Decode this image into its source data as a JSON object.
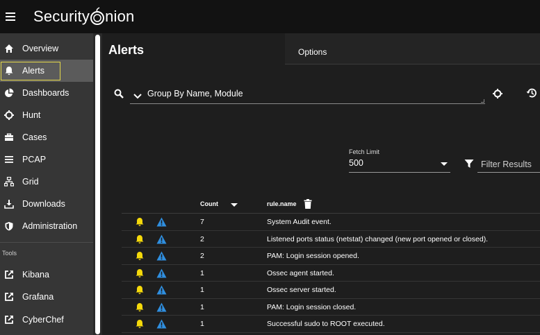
{
  "app": {
    "brand_left": "Security",
    "brand_right": "nion"
  },
  "sidebar": {
    "items": [
      {
        "label": "Overview",
        "icon": "home-icon"
      },
      {
        "label": "Alerts",
        "icon": "bell-icon"
      },
      {
        "label": "Dashboards",
        "icon": "pie-chart-icon"
      },
      {
        "label": "Hunt",
        "icon": "crosshairs-icon"
      },
      {
        "label": "Cases",
        "icon": "briefcase-icon"
      },
      {
        "label": "PCAP",
        "icon": "lines-icon"
      },
      {
        "label": "Grid",
        "icon": "sitemap-icon"
      },
      {
        "label": "Downloads",
        "icon": "download-icon"
      },
      {
        "label": "Administration",
        "icon": "shield-icon"
      }
    ],
    "tools_label": "Tools",
    "tools": [
      {
        "label": "Kibana",
        "icon": "external-link-icon"
      },
      {
        "label": "Grafana",
        "icon": "external-link-icon"
      },
      {
        "label": "CyberChef",
        "icon": "external-link-icon"
      }
    ]
  },
  "main": {
    "title": "Alerts",
    "options_tab": "Options",
    "query": "Group By Name, Module",
    "fetch_limit_label": "Fetch Limit",
    "fetch_limit_value": "500",
    "filter_placeholder": "Filter Results"
  },
  "table": {
    "headers": {
      "count": "Count",
      "rule_name": "rule.name"
    },
    "rows": [
      {
        "count": "7",
        "rule_name": "System Audit event."
      },
      {
        "count": "2",
        "rule_name": "Listened ports status (netstat) changed (new port opened or closed)."
      },
      {
        "count": "2",
        "rule_name": "PAM: Login session opened."
      },
      {
        "count": "1",
        "rule_name": "Ossec agent started."
      },
      {
        "count": "1",
        "rule_name": "Ossec server started."
      },
      {
        "count": "1",
        "rule_name": "PAM: Login session closed."
      },
      {
        "count": "1",
        "rule_name": "Successful sudo to ROOT executed."
      }
    ]
  },
  "colors": {
    "accent_yellow": "#f5d90a",
    "warning_blue": "#2f8fe0",
    "focus_outline": "#e5d84a"
  }
}
